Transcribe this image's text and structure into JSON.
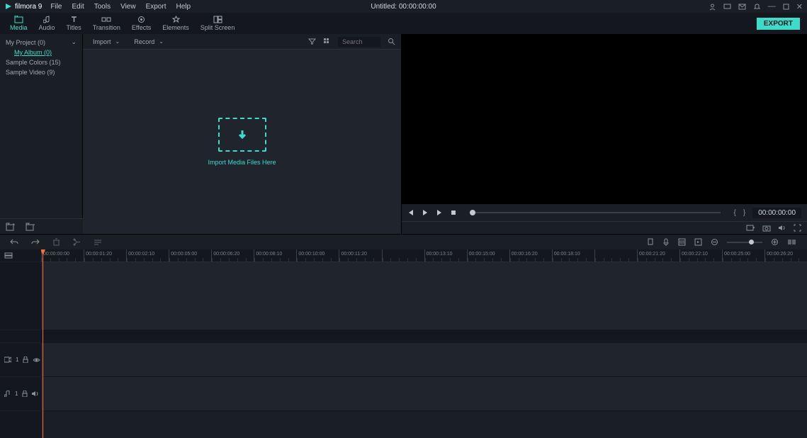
{
  "app": {
    "name": "filmora 9"
  },
  "menubar": [
    "File",
    "Edit",
    "Tools",
    "View",
    "Export",
    "Help"
  ],
  "title": "Untitled: 00:00:00:00",
  "tool_tabs": [
    {
      "label": "Media",
      "active": true
    },
    {
      "label": "Audio"
    },
    {
      "label": "Titles"
    },
    {
      "label": "Transition"
    },
    {
      "label": "Effects"
    },
    {
      "label": "Elements"
    },
    {
      "label": "Split Screen"
    }
  ],
  "export_label": "EXPORT",
  "sidebar": {
    "items": [
      {
        "label": "My Project (0)",
        "expandable": true
      },
      {
        "label": "My Album (0)",
        "indented": true
      },
      {
        "label": "Sample Colors (15)"
      },
      {
        "label": "Sample Video (9)"
      }
    ]
  },
  "media": {
    "import_label": "Import",
    "record_label": "Record",
    "search_placeholder": "Search",
    "drop_text": "Import Media Files Here"
  },
  "preview": {
    "timecode": "00:00:00:00"
  },
  "timeline": {
    "ruler": [
      "00:00:00:00",
      "00:00:01:20",
      "00:00:02:10",
      "00:00:05:00",
      "00:00:06:20",
      "00:00:08:10",
      "00:00:10:00",
      "00:00:11:20",
      "",
      "00:00:13:10",
      "00:00:15:00",
      "00:00:16:20",
      "00:00:18:10",
      "",
      "00:00:21:20",
      "00:00:22:10",
      "00:00:25:00",
      "00:00:26:20"
    ],
    "tracks": {
      "video": "1",
      "audio": "1"
    }
  }
}
